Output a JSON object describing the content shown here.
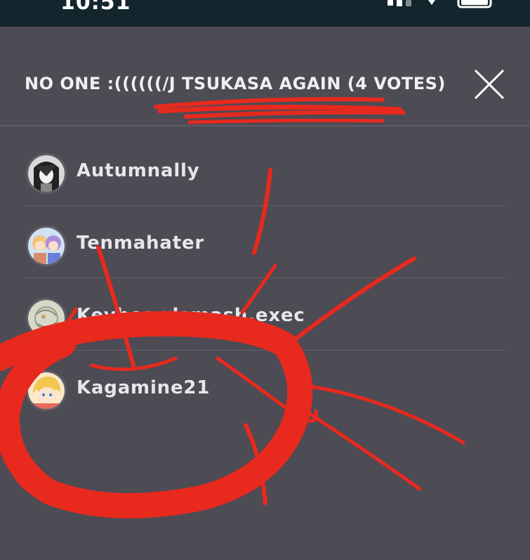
{
  "status_bar": {
    "time": "10:51"
  },
  "header": {
    "title": "NO ONE :((((((/J TSUKASA AGAIN (4 VOTES)",
    "close_icon": "close-icon"
  },
  "voters": [
    {
      "name": "Autumnally",
      "avatar": "avatar-monochrome-anime-character"
    },
    {
      "name": "Tenmahater",
      "avatar": "avatar-two-anime-characters"
    },
    {
      "name": "Keyboardsmash.exec",
      "avatar": "avatar-sketch-drawing"
    },
    {
      "name": "Kagamine21",
      "avatar": "avatar-blonde-anime-character"
    }
  ],
  "colors": {
    "background": "#4d4b54",
    "status_bar": "#13262e",
    "scribble": "#e8291e",
    "text": "#e7e6ea"
  }
}
